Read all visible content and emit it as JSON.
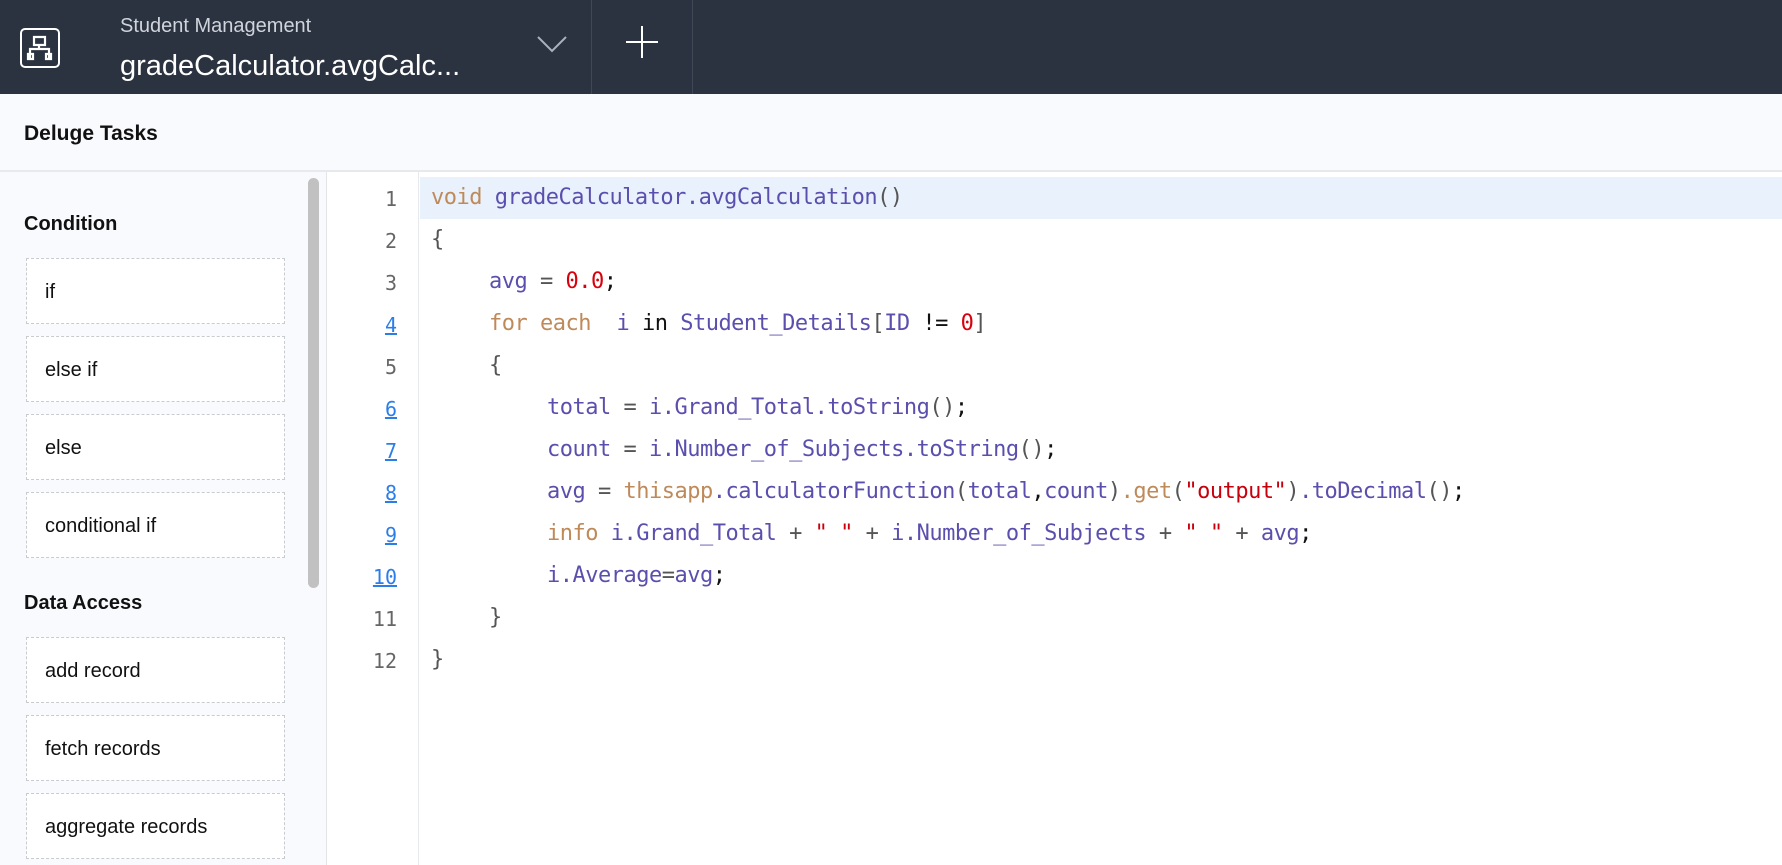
{
  "header": {
    "app_name": "Student Management",
    "function_title": "gradeCalculator.avgCalc..."
  },
  "tasks_title": "Deluge Tasks",
  "sidebar": {
    "sections": [
      {
        "title": "Condition",
        "items": [
          "if",
          "else if",
          "else",
          "conditional if"
        ]
      },
      {
        "title": "Data Access",
        "items": [
          "add record",
          "fetch records",
          "aggregate records"
        ]
      }
    ]
  },
  "colors": {
    "header_bg": "#2b3240",
    "keyword": "#bf8a5a",
    "identifier": "#5b4fae",
    "number": "#d8000c",
    "line_link": "#2b7de9"
  },
  "editor": {
    "lines": [
      {
        "n": "1",
        "bp": false,
        "indent": 0,
        "tokens": [
          [
            "kw",
            "void "
          ],
          [
            "id",
            "gradeCalculator.avgCalculation"
          ],
          [
            "pn",
            "()"
          ]
        ]
      },
      {
        "n": "2",
        "bp": false,
        "indent": 0,
        "tokens": [
          [
            "pn",
            "{"
          ]
        ]
      },
      {
        "n": "3",
        "bp": false,
        "indent": 1,
        "tokens": [
          [
            "id",
            "avg"
          ],
          [
            "pn",
            " = "
          ],
          [
            "num",
            "0.0"
          ],
          [
            "pl",
            ";"
          ]
        ]
      },
      {
        "n": "4",
        "bp": true,
        "indent": 1,
        "tokens": [
          [
            "kw",
            "for each  "
          ],
          [
            "id",
            "i "
          ],
          [
            "pl",
            "in "
          ],
          [
            "id",
            "Student_Details"
          ],
          [
            "pn",
            "["
          ],
          [
            "id",
            "ID "
          ],
          [
            "pl",
            "!= "
          ],
          [
            "num",
            "0"
          ],
          [
            "pn",
            "]"
          ]
        ]
      },
      {
        "n": "5",
        "bp": false,
        "indent": 1,
        "tokens": [
          [
            "pn",
            "{"
          ]
        ]
      },
      {
        "n": "6",
        "bp": true,
        "indent": 2,
        "tokens": [
          [
            "id",
            "total"
          ],
          [
            "pn",
            " = "
          ],
          [
            "id",
            "i.Grand_Total.toString"
          ],
          [
            "pn",
            "()"
          ],
          [
            "pl",
            ";"
          ]
        ]
      },
      {
        "n": "7",
        "bp": true,
        "indent": 2,
        "tokens": [
          [
            "id",
            "count"
          ],
          [
            "pn",
            " = "
          ],
          [
            "id",
            "i.Number_of_Subjects.toString"
          ],
          [
            "pn",
            "()"
          ],
          [
            "pl",
            ";"
          ]
        ]
      },
      {
        "n": "8",
        "bp": true,
        "indent": 2,
        "tokens": [
          [
            "id",
            "avg"
          ],
          [
            "pn",
            " = "
          ],
          [
            "kw",
            "thisapp"
          ],
          [
            "id",
            ".calculatorFunction"
          ],
          [
            "pn",
            "("
          ],
          [
            "id",
            "total"
          ],
          [
            "pl",
            ","
          ],
          [
            "id",
            "count"
          ],
          [
            "pn",
            ")"
          ],
          [
            "kw",
            ".get"
          ],
          [
            "pn",
            "("
          ],
          [
            "str",
            "\"output\""
          ],
          [
            "pn",
            ")"
          ],
          [
            "id",
            ".toDecimal"
          ],
          [
            "pn",
            "()"
          ],
          [
            "pl",
            ";"
          ]
        ]
      },
      {
        "n": "9",
        "bp": true,
        "indent": 2,
        "tokens": [
          [
            "kw",
            "info "
          ],
          [
            "id",
            "i.Grand_Total"
          ],
          [
            "pn",
            " + "
          ],
          [
            "str",
            "\" \""
          ],
          [
            "pn",
            " + "
          ],
          [
            "id",
            "i.Number_of_Subjects"
          ],
          [
            "pn",
            " + "
          ],
          [
            "str",
            "\" \""
          ],
          [
            "pn",
            " + "
          ],
          [
            "id",
            "avg"
          ],
          [
            "pl",
            ";"
          ]
        ]
      },
      {
        "n": "10",
        "bp": true,
        "indent": 2,
        "tokens": [
          [
            "id",
            "i.Average"
          ],
          [
            "pn",
            "="
          ],
          [
            "id",
            "avg"
          ],
          [
            "pl",
            ";"
          ]
        ]
      },
      {
        "n": "11",
        "bp": false,
        "indent": 1,
        "tokens": [
          [
            "pn",
            "}"
          ]
        ]
      },
      {
        "n": "12",
        "bp": false,
        "indent": 0,
        "tokens": [
          [
            "pn",
            "}"
          ]
        ]
      }
    ]
  }
}
